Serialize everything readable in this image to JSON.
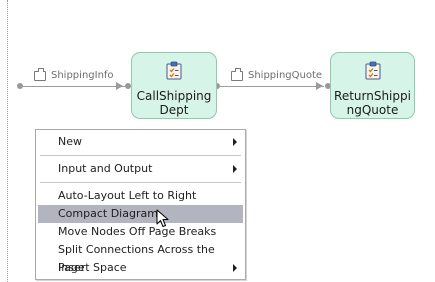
{
  "diagram": {
    "connections": [
      {
        "label": "ShippingInfo",
        "icon": "message-envelope-icon"
      },
      {
        "label": "ShippingQuote",
        "icon": "message-envelope-icon"
      }
    ],
    "nodes": [
      {
        "label": "CallShipping Dept",
        "icon": "task-clipboard-icon"
      },
      {
        "label": "ReturnShippi ngQuote",
        "icon": "task-clipboard-icon"
      }
    ],
    "colors": {
      "node_fill": "#d7f4e9",
      "node_border": "#8ec9b1",
      "wire": "#9c9c9c"
    }
  },
  "context_menu": {
    "items": [
      {
        "label": "New",
        "submenu": true
      },
      {
        "label": "Input and Output",
        "submenu": true
      },
      {
        "label": "Auto-Layout Left to Right",
        "submenu": false
      },
      {
        "label": "Compact Diagram",
        "submenu": false,
        "highlighted": true
      },
      {
        "label": "Move Nodes Off Page Breaks",
        "submenu": false
      },
      {
        "label": "Split Connections Across the Page",
        "submenu": false
      },
      {
        "label": "Insert Space",
        "submenu": true
      }
    ],
    "highlight_color": "#b2b4bf"
  }
}
